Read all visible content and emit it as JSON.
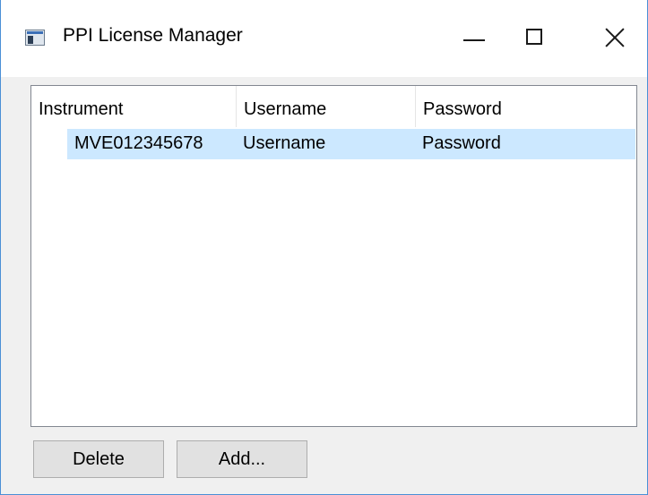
{
  "window": {
    "title": "PPI License Manager",
    "controls": {
      "minimize": "minimize",
      "maximize": "maximize",
      "close": "close"
    }
  },
  "license_list": {
    "columns": [
      "Instrument",
      "Username",
      "Password"
    ],
    "rows": [
      {
        "instrument": "MVE012345678",
        "username": "Username",
        "password": "Password",
        "selected": true
      }
    ],
    "selection_color": "#cce8ff"
  },
  "buttons": {
    "delete_label": "Delete",
    "add_label": "Add..."
  },
  "icons": {
    "app": "application-window-icon",
    "minimize": "minimize-icon",
    "maximize": "maximize-icon",
    "close": "close-icon"
  },
  "colors": {
    "window_border": "#4a8fd6",
    "dialog_background": "#f0f0f0",
    "button_face": "#e1e1e1"
  }
}
